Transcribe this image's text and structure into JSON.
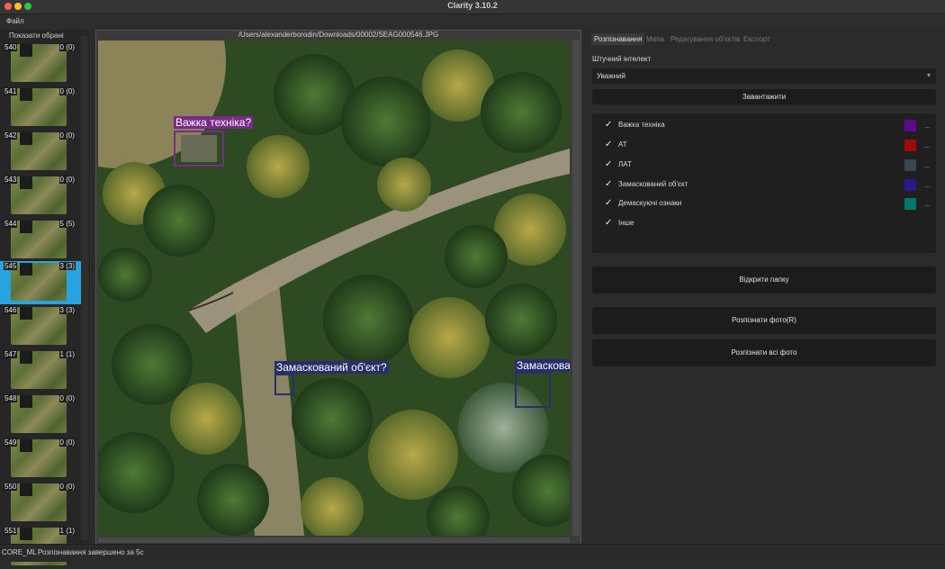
{
  "window": {
    "title": "Clarity 3.10.2"
  },
  "menu": {
    "file": "Файл"
  },
  "left": {
    "show_selected": "Показати обрані",
    "thumbnails": [
      {
        "num": "540",
        "count": "0 (0)"
      },
      {
        "num": "541",
        "count": "0 (0)"
      },
      {
        "num": "542",
        "count": "0 (0)"
      },
      {
        "num": "543",
        "count": "0 (0)"
      },
      {
        "num": "544",
        "count": "5 (5)"
      },
      {
        "num": "545",
        "count": "3 (3)"
      },
      {
        "num": "546",
        "count": "3 (3)"
      },
      {
        "num": "547",
        "count": "1 (1)"
      },
      {
        "num": "548",
        "count": "0 (0)"
      },
      {
        "num": "549",
        "count": "0 (0)"
      },
      {
        "num": "550",
        "count": "0 (0)"
      },
      {
        "num": "551",
        "count": "1 (1)"
      }
    ],
    "selected_thumbnail": "545"
  },
  "viewer": {
    "path": "/Users/alexanderborodin/Downloads/00002/SEAG000546.JPG",
    "detections": [
      {
        "label": "Важка техніка?",
        "color": "#7a2a8a"
      },
      {
        "label": "Замаскований об'єкт?",
        "color": "#2a2e6a"
      },
      {
        "label": "Замаскован",
        "color": "#2a2e6a"
      }
    ]
  },
  "right": {
    "tabs": [
      "Розпізнавання",
      "Мапа",
      "Редагування об'єктів",
      "Експорт"
    ],
    "active_tab": "Розпізнавання",
    "ai_label": "Штучний інтелект",
    "model_select": "Уважний",
    "load_button": "Завантажити",
    "classes": [
      {
        "name": "Важка техніка",
        "color": "#5a0a8a",
        "more": "..."
      },
      {
        "name": "АТ",
        "color": "#a00a0a",
        "more": "..."
      },
      {
        "name": "ЛАТ",
        "color": "#37474f",
        "more": "..."
      },
      {
        "name": "Замаскований об'єкт",
        "color": "#281a8a",
        "more": "..."
      },
      {
        "name": "Демаскуючі ознаки",
        "color": "#00796b",
        "more": "..."
      },
      {
        "name": "Інше"
      }
    ],
    "open_folder": "Відкрити папку",
    "recognize_photo": "Розпізнати фото(R)",
    "recognize_all": "Розпізнати всі фото"
  },
  "status": {
    "engine": "CORE_ML",
    "message": "Розпізнавання завершено за 5с"
  }
}
